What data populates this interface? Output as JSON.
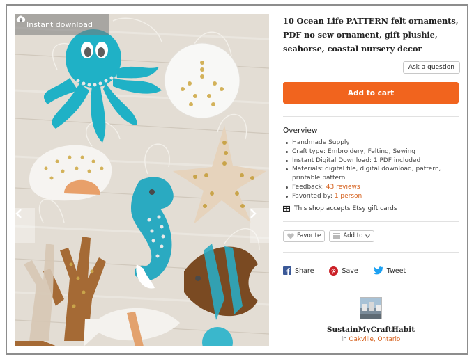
{
  "media": {
    "badge_label": "Instant download",
    "download_icon": "cloud-download-icon",
    "prev_icon": "chevron-left-icon",
    "next_icon": "chevron-right-icon"
  },
  "listing": {
    "title": "10 Ocean Life PATTERN felt ornaments, PDF no sew ornament, gift plushie, seahorse, coastal nursery decor",
    "ask_label": "Ask a question",
    "cart_label": "Add to cart",
    "cart_color": "#f1641e"
  },
  "overview": {
    "heading": "Overview",
    "items": [
      "Handmade Supply",
      "Craft type: Embroidery, Felting, Sewing",
      "Instant Digital Download: 1 PDF included",
      "Materials: digital file, digital download, pattern, printable pattern"
    ],
    "feedback_label": "Feedback: ",
    "feedback_link": "43 reviews",
    "favorited_label": "Favorited by: ",
    "favorited_link": "1 person",
    "gift_label": "This shop accepts Etsy gift cards",
    "gift_icon": "gift-card-icon"
  },
  "actions": {
    "favorite_label": "Favorite",
    "favorite_icon": "heart-icon",
    "addto_label": "Add to",
    "addto_icon": "list-icon",
    "addto_chevron": "chevron-down-icon"
  },
  "share": {
    "facebook_label": "Share",
    "pinterest_label": "Save",
    "twitter_label": "Tweet",
    "facebook_color": "#3b5998",
    "pinterest_color": "#cb2027",
    "twitter_color": "#1da1f2"
  },
  "shop": {
    "name": "SustainMyCraftHabit",
    "loc_prefix": "in ",
    "location": "Oakville, Ontario"
  }
}
